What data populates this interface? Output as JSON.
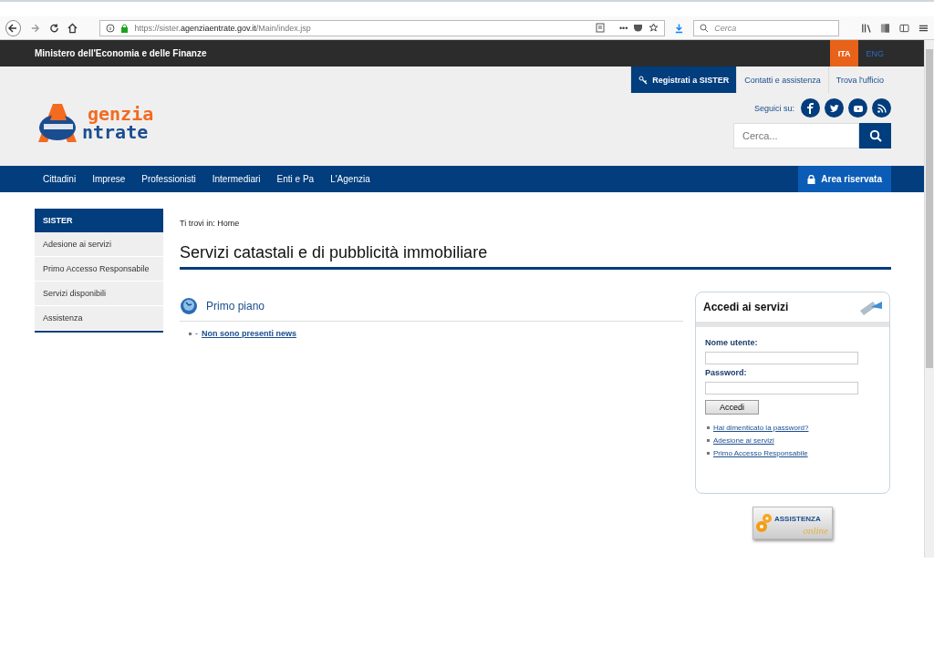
{
  "browser": {
    "url_prefix": "https://sister.",
    "url_domain": "agenziaentrate.gov.it",
    "url_path": "/Main/index.jsp",
    "menu_dots": "•••",
    "search_placeholder": "Cerca"
  },
  "topbar": {
    "ministry": "Ministero dell'Economia e delle Finanze",
    "languages": [
      {
        "label": "ITA",
        "selected": true
      },
      {
        "label": "ENG",
        "selected": false
      }
    ]
  },
  "header": {
    "logo_top": "genzia",
    "logo_bottom": "ntrate",
    "links": [
      {
        "label": "Registrati a SISTER",
        "kind": "primary"
      },
      {
        "label": "Contatti e assistenza",
        "kind": "plain"
      },
      {
        "label": "Trova l'ufficio",
        "kind": "plain"
      }
    ],
    "follow": "Seguici su:",
    "search_placeholder": "Cerca..."
  },
  "nav": {
    "items": [
      "Cittadini",
      "Imprese",
      "Professionisti",
      "Intermediari",
      "Enti e Pa",
      "L'Agenzia"
    ],
    "reserved": "Area riservata"
  },
  "sidebar": {
    "title": "SISTER",
    "items": [
      "Adesione ai servizi",
      "Primo Accesso Responsabile",
      "Servizi disponibili",
      "Assistenza"
    ]
  },
  "breadcrumb": {
    "prefix": "Ti trovi in:",
    "current": "Home"
  },
  "page_title": "Servizi catastali e di pubblicità immobiliare",
  "news": {
    "title": "Primo piano",
    "items": [
      {
        "dash": "-",
        "text": "Non sono presenti news"
      }
    ]
  },
  "login": {
    "title": "Accedi ai servizi",
    "username_label": "Nome utente:",
    "password_label": "Password:",
    "button": "Accedi",
    "links": [
      "Hai dimenticato la password?",
      "Adesione ai servizi",
      "Primo Accesso Responsabile"
    ]
  },
  "assistance": {
    "line1": "ASSISTENZA",
    "line2": "online"
  }
}
